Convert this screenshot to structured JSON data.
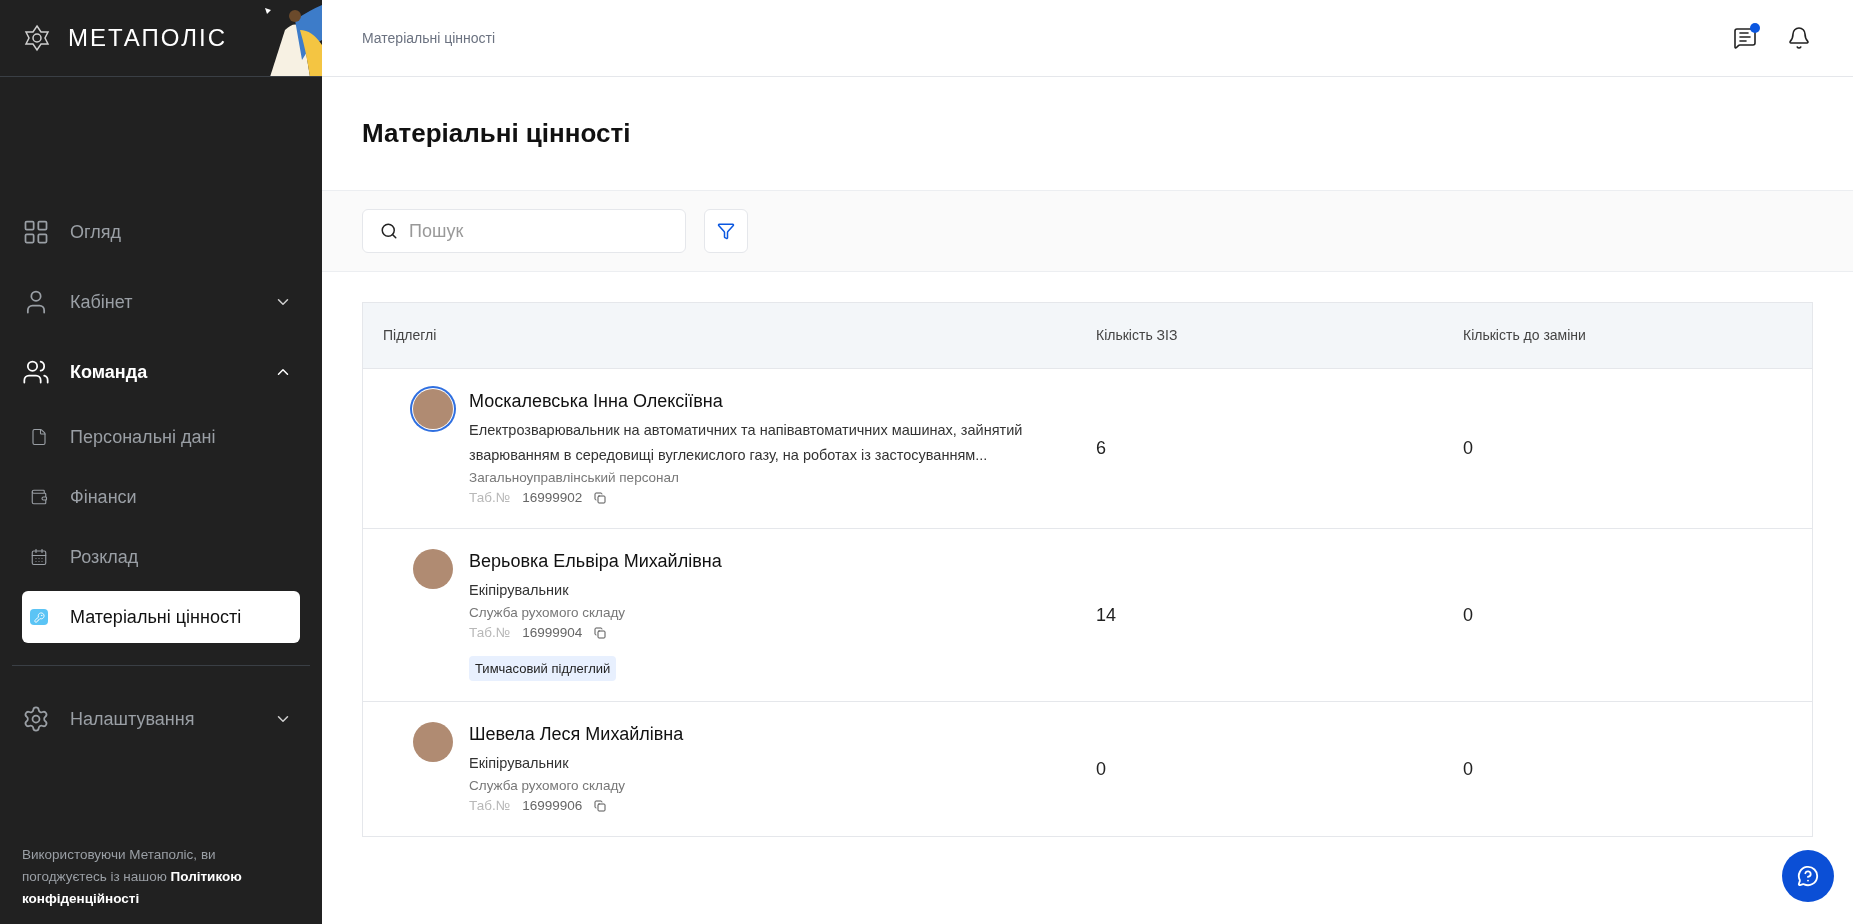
{
  "sidebar": {
    "logo": "МЕТАПОЛІС",
    "items": [
      {
        "label": "Огляд",
        "expandable": false,
        "expanded": false,
        "selected": false
      },
      {
        "label": "Кабінет",
        "expandable": true,
        "expanded": false,
        "selected": false
      },
      {
        "label": "Команда",
        "expandable": true,
        "expanded": true,
        "selected": false,
        "children": [
          {
            "label": "Персональні дані",
            "selected": false
          },
          {
            "label": "Фінанси",
            "selected": false
          },
          {
            "label": "Розклад",
            "selected": false
          },
          {
            "label": "Матеріальні цінності",
            "selected": true
          }
        ]
      },
      {
        "label": "Налаштування",
        "expandable": true,
        "expanded": false,
        "selected": false
      }
    ],
    "footer": "Використовуючи Метаполіс, ви погоджуєтесь із нашою **Політикою конфіденційності**"
  },
  "breadcrumb": "Матеріальні цінності",
  "header": {
    "chat_unread": true
  },
  "title": "Матеріальні цінності",
  "search": {
    "placeholder": "Пошук"
  },
  "table": {
    "columns": [
      "Підлеглі",
      "Кількість ЗІЗ",
      "Кількість до заміни"
    ],
    "rows": [
      {
        "name": "Москалевська Інна Олексіївна",
        "selected": true,
        "position": "Електрозварювальник на автоматичних та напівавтоматичних машинах, зайнятий зварюванням в середовищі вуглекислого газу, на роботах із застосуванням...",
        "department": "Загальноуправлінський персонал",
        "tab_label": "Таб.№",
        "tab_number": "16999902",
        "badge": null,
        "ppe": "6",
        "replace": "0"
      },
      {
        "name": "Верьовка Ельвіра Михайлівна",
        "selected": false,
        "position": "Екіпірувальник",
        "department": "Служба рухомого складу",
        "tab_label": "Таб.№",
        "tab_number": "16999904",
        "badge": "Тимчасовий підлеглий",
        "ppe": "14",
        "replace": "0"
      },
      {
        "name": "Шевела Леся Михайлівна",
        "selected": false,
        "position": "Екіпірувальник",
        "department": "Служба рухомого складу",
        "tab_label": "Таб.№",
        "tab_number": "16999906",
        "badge": null,
        "ppe": "0",
        "replace": "0"
      }
    ]
  }
}
